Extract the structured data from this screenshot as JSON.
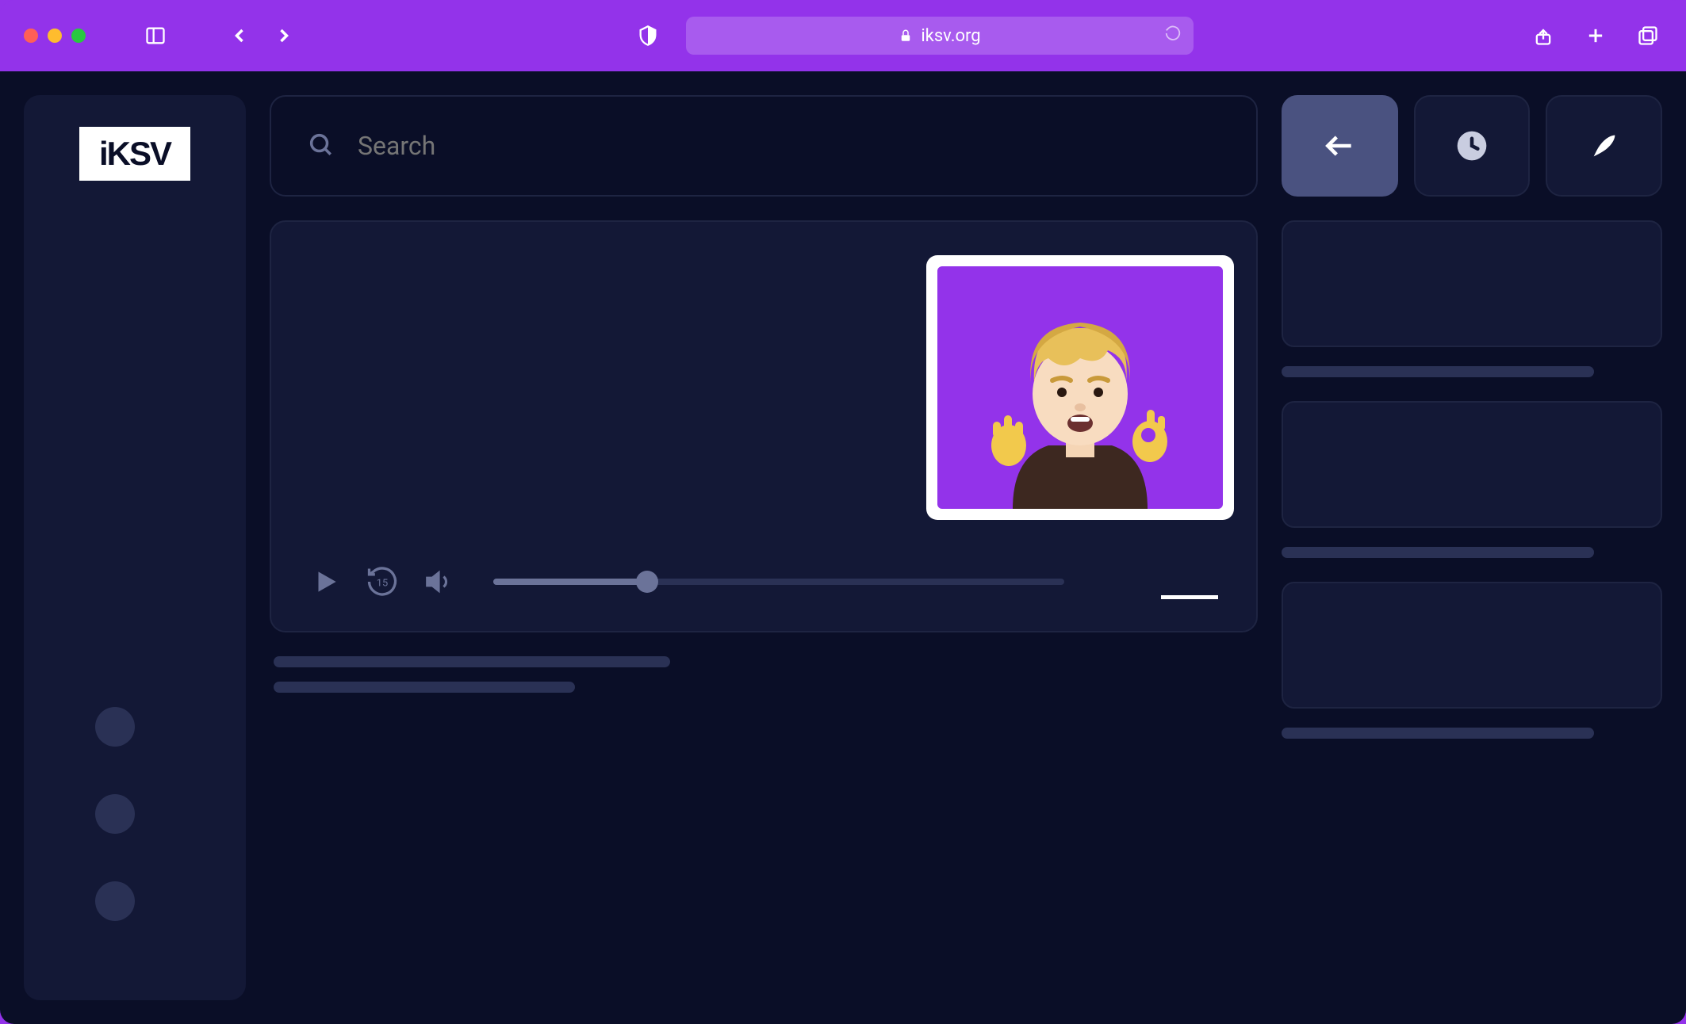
{
  "browser": {
    "url": "iksv.org"
  },
  "app": {
    "logo_text": "iKSV",
    "search": {
      "placeholder": "Search"
    },
    "video": {
      "replay_seconds": "15",
      "progress_percent": 27
    },
    "colors": {
      "theme_purple": "#9333ea",
      "dark_bg": "#0a0e27",
      "panel_bg": "#131836",
      "border": "#1e2442",
      "muted": "#6b7399",
      "skeleton": "#2a3155",
      "active_button": "#4a5280"
    }
  }
}
